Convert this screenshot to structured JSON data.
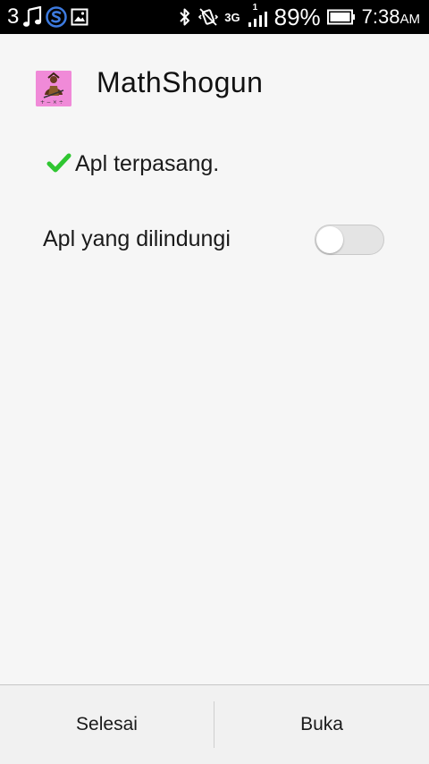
{
  "status_bar": {
    "notif_count": "3",
    "battery_pct": "89%",
    "network": "3G",
    "signal_badge": "1",
    "time": "7:38",
    "ampm": "AM",
    "icons": [
      "music-icon",
      "s-app-icon",
      "image-icon",
      "bluetooth-icon",
      "vibrate-icon",
      "signal-icon",
      "battery-icon"
    ]
  },
  "header": {
    "app_name": "MathShogun",
    "app_icon_color": "#f08ad8"
  },
  "status": {
    "text": "Apl terpasang.",
    "check_color": "#2fc631"
  },
  "protected_apps": {
    "label": "Apl yang dilindungi",
    "enabled": false
  },
  "actions": {
    "done_label": "Selesai",
    "open_label": "Buka"
  }
}
